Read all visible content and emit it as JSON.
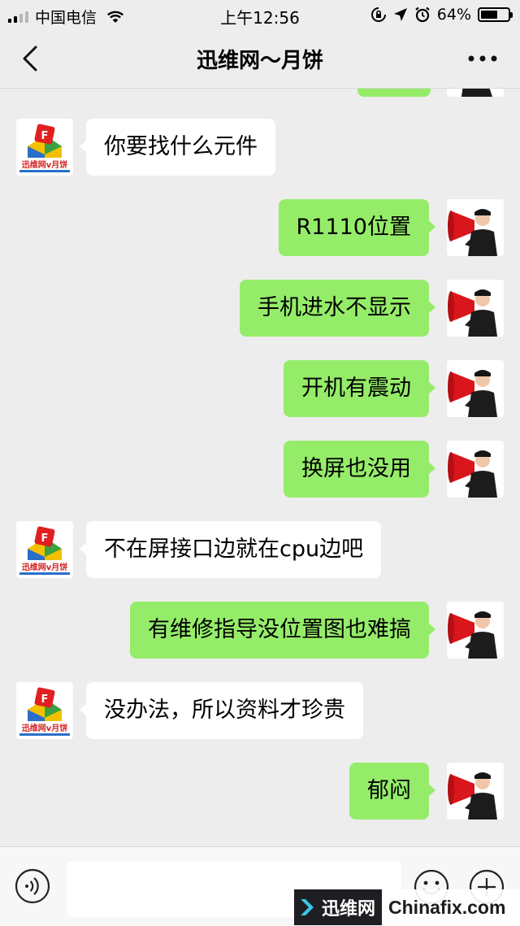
{
  "status_bar": {
    "carrier": "中国电信",
    "time": "上午12:56",
    "battery": "64%",
    "battery_level": 0.64,
    "icons": [
      "signal-icon",
      "wifi-icon",
      "rotation-lock-icon",
      "location-icon",
      "alarm-icon",
      "battery-icon"
    ]
  },
  "nav": {
    "title": "迅维网～月饼",
    "back_icon": "chevron-left-icon",
    "more_icon": "more-dots-icon"
  },
  "avatars": {
    "contact_text": "迅维网v月饼",
    "self_icon": "megaphone-man-icon"
  },
  "messages": [
    {
      "side": "in",
      "text": "你要找什么元件"
    },
    {
      "side": "out",
      "text": "R1110位置"
    },
    {
      "side": "out",
      "text": "手机进水不显示"
    },
    {
      "side": "out",
      "text": "开机有震动"
    },
    {
      "side": "out",
      "text": "换屏也没用"
    },
    {
      "side": "in",
      "text": "不在屏接口边就在cpu边吧"
    },
    {
      "side": "out",
      "text": "有维修指导没位置图也难搞"
    },
    {
      "side": "in",
      "text": "没办法，所以资料才珍贵"
    },
    {
      "side": "out",
      "text": "郁闷"
    }
  ],
  "input_bar": {
    "voice_icon": "voice-icon",
    "emoji_icon": "emoji-icon",
    "plus_icon": "plus-icon",
    "text_value": ""
  },
  "watermark": {
    "logo_text": "迅维网",
    "site": "Chinafix.com"
  },
  "colors": {
    "background": "#ededed",
    "outgoing_bubble": "#95ec69",
    "incoming_bubble": "#ffffff"
  }
}
